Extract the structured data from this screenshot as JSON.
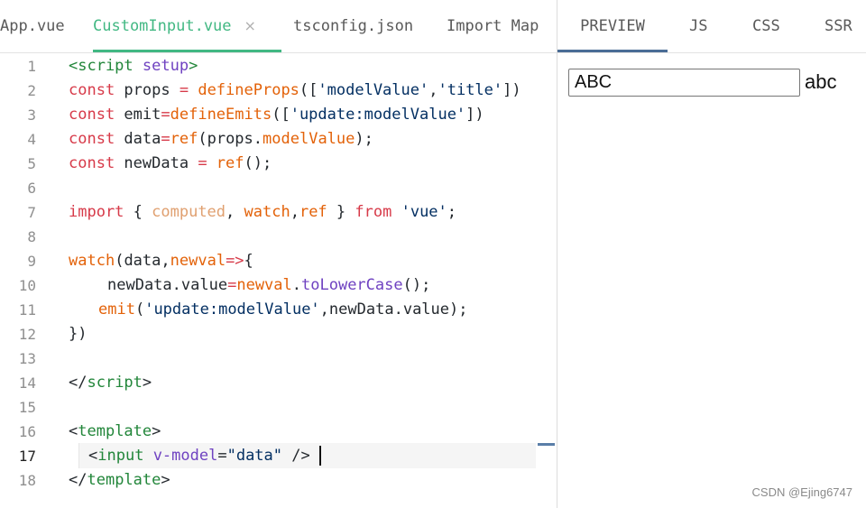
{
  "editor_tabs": [
    {
      "label": "App.vue"
    },
    {
      "label": "CustomInput.vue",
      "close": "×"
    },
    {
      "label": "tsconfig.json"
    },
    {
      "label": "Import Map"
    }
  ],
  "preview_tabs": [
    {
      "label": "PREVIEW"
    },
    {
      "label": "JS"
    },
    {
      "label": "CSS"
    },
    {
      "label": "SSR"
    }
  ],
  "code_lines": [
    "1",
    "2",
    "3",
    "4",
    "5",
    "6",
    "7",
    "8",
    "9",
    "10",
    "11",
    "12",
    "13",
    "14",
    "15",
    "16",
    "17",
    "18"
  ],
  "code": {
    "l1": {
      "a": "<script ",
      "b": "setup",
      "c": ">"
    },
    "l2": {
      "a": "const ",
      "b": "props",
      "c": " = ",
      "d": "defineProps",
      "e": "([",
      "f": "'modelValue'",
      "g": ",",
      "h": "'title'",
      "i": "])"
    },
    "l3": {
      "a": "const ",
      "b": "emit",
      "c": "=",
      "d": "defineEmits",
      "e": "([",
      "f": "'update:modelValue'",
      "g": "])"
    },
    "l4": {
      "a": "const ",
      "b": "data",
      "c": "=",
      "d": "ref",
      "e": "(",
      "f": "props",
      "g": ".",
      "h": "modelValue",
      "i": ");"
    },
    "l5": {
      "a": "const ",
      "b": "newData",
      "c": " = ",
      "d": "ref",
      "e": "();"
    },
    "l7": {
      "a": "import",
      "b": " { ",
      "c": "computed",
      "d": ", ",
      "e": "watch",
      "f": ",",
      "g": "ref",
      "h": " } ",
      "i": "from",
      "j": " ",
      "k": "'vue'",
      "l": ";"
    },
    "l9": {
      "a": "watch",
      "b": "(",
      "c": "data",
      "d": ",",
      "e": "newval",
      "f": "=>",
      "g": "{"
    },
    "l10": {
      "a": "newData",
      "b": ".",
      "c": "value",
      "d": "=",
      "e": "newval",
      "f": ".",
      "g": "toLowerCase",
      "h": "();"
    },
    "l11": {
      "a": "emit",
      "b": "(",
      "c": "'update:modelValue'",
      "d": ",",
      "e": "newData",
      "f": ".",
      "g": "value",
      "h": ");"
    },
    "l12": {
      "a": "})"
    },
    "l14": {
      "a": "</",
      "b": "script",
      "c": ">"
    },
    "l16": {
      "a": "<",
      "b": "template",
      "c": ">"
    },
    "l17": {
      "a": "<",
      "b": "input",
      "c": " ",
      "d": "v-model",
      "e": "=",
      "f": "\"data\"",
      "g": " />"
    },
    "l18": {
      "a": "</",
      "b": "template",
      "c": ">"
    }
  },
  "preview": {
    "input_value": "ABC",
    "output_text": "abc"
  },
  "watermark": "CSDN @Ejing6747",
  "colors": {
    "accent": "#42b883",
    "keyword": "#d73a49",
    "function": "#6f42c1",
    "string": "#032f62",
    "tag": "#22863a"
  }
}
